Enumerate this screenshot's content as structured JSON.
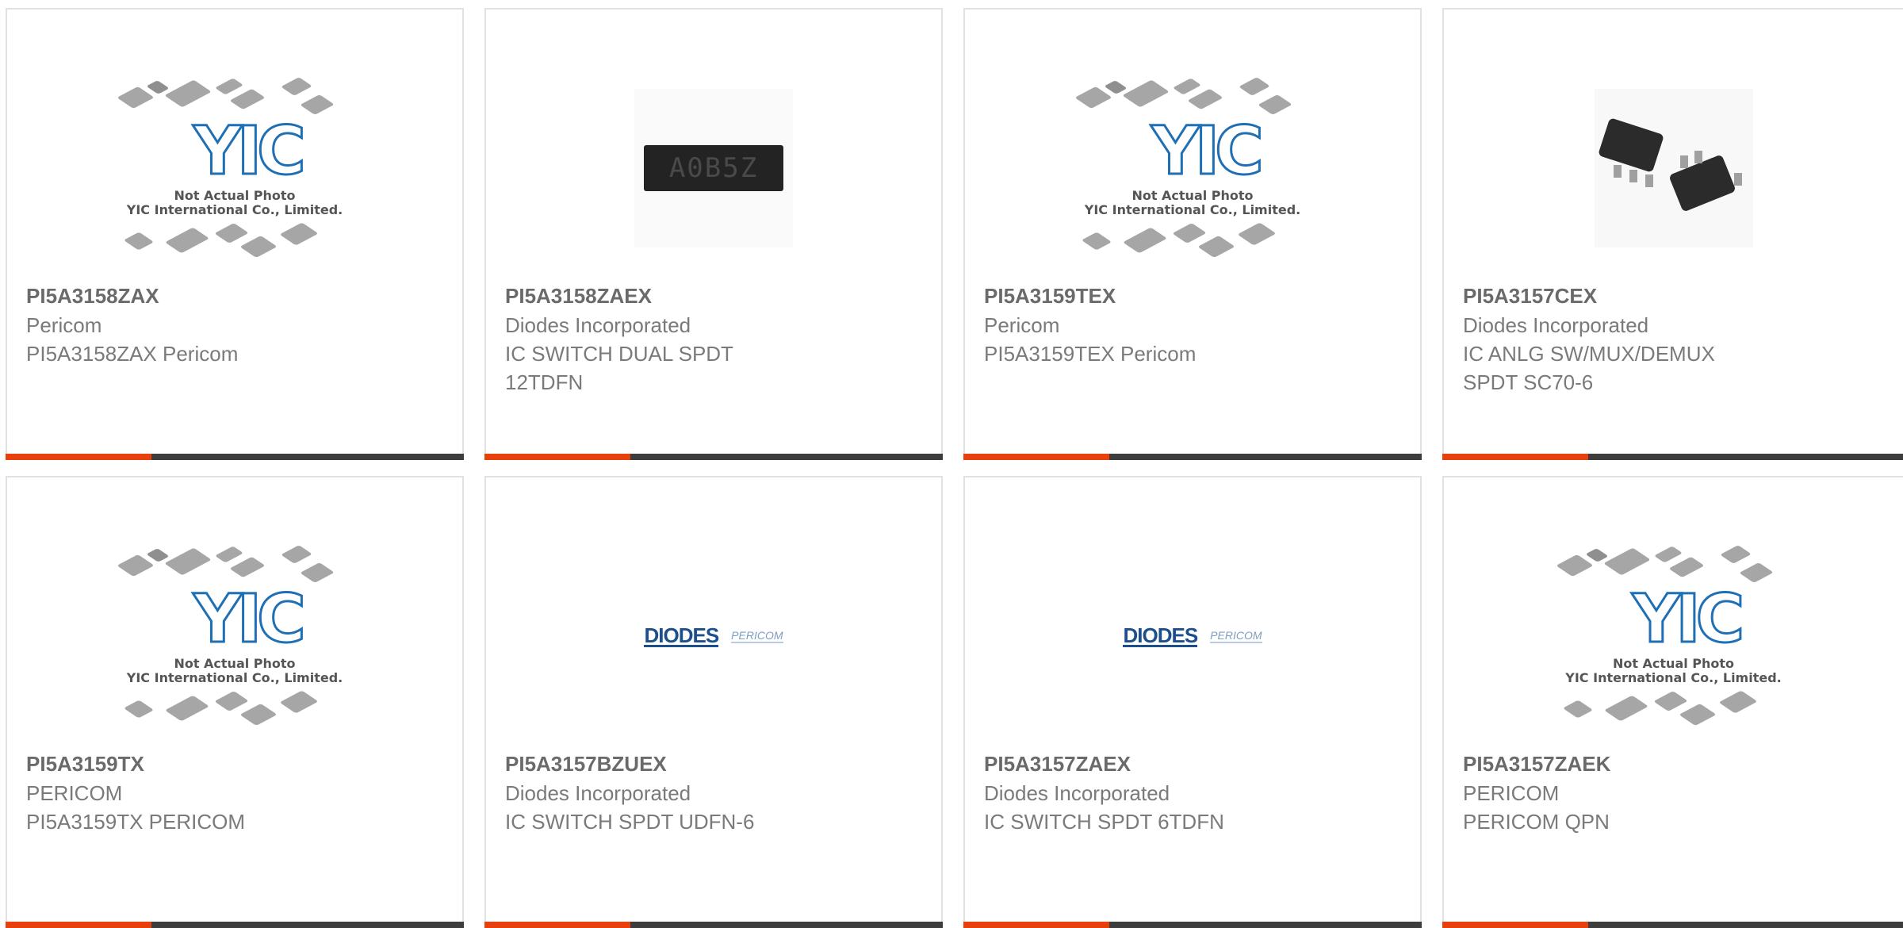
{
  "products": [
    {
      "part_number": "PI5A3158ZAX",
      "manufacturer": "Pericom",
      "description": "PI5A3158ZAX Pericom",
      "image": "yic-placeholder",
      "image_caption": [
        "Not Actual Photo",
        "YIC International Co., Limited."
      ]
    },
    {
      "part_number": "PI5A3158ZAEX",
      "manufacturer": "Diodes Incorporated",
      "description": "IC SWITCH DUAL SPDT 12TDFN",
      "image": "ic-chip-photo",
      "chip_marking": "A0B5Z"
    },
    {
      "part_number": "PI5A3159TEX",
      "manufacturer": "Pericom",
      "description": "PI5A3159TEX Pericom",
      "image": "yic-placeholder",
      "image_caption": [
        "Not Actual Photo",
        "YIC International Co., Limited."
      ]
    },
    {
      "part_number": "PI5A3157CEX",
      "manufacturer": "Diodes Incorporated",
      "description": "IC ANLG SW/MUX/DEMUX SPDT SC70-6",
      "image": "sc70-package-photo"
    },
    {
      "part_number": "PI5A3159TX",
      "manufacturer": "PERICOM",
      "description": "PI5A3159TX PERICOM",
      "image": "yic-placeholder",
      "image_caption": [
        "Not Actual Photo",
        "YIC International Co., Limited."
      ]
    },
    {
      "part_number": "PI5A3157BZUEX",
      "manufacturer": "Diodes Incorporated",
      "description": "IC SWITCH SPDT UDFN-6",
      "image": "diodes-pericom-logo",
      "logo_text": [
        "DIODES",
        "PERICOM"
      ]
    },
    {
      "part_number": "PI5A3157ZAEX",
      "manufacturer": "Diodes Incorporated",
      "description": "IC SWITCH SPDT 6TDFN",
      "image": "diodes-pericom-logo",
      "logo_text": [
        "DIODES",
        "PERICOM"
      ]
    },
    {
      "part_number": "PI5A3157ZAEK",
      "manufacturer": "PERICOM",
      "description": "PERICOM QPN",
      "image": "yic-placeholder",
      "image_caption": [
        "Not Actual Photo",
        "YIC International Co., Limited."
      ]
    }
  ],
  "yic_logo": "YIC",
  "colors": {
    "accent": "#e8400c",
    "bar": "#3d3d3d",
    "border": "#e1e1e1",
    "text": "#7a7a7a",
    "logo_blue": "#1f6fb5"
  }
}
